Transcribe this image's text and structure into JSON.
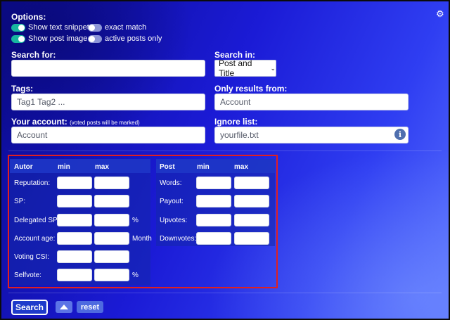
{
  "options": {
    "title": "Options:",
    "toggles": [
      {
        "label": "Show text snippets",
        "on": true
      },
      {
        "label": "exact match",
        "on": false
      },
      {
        "label": "Show post image",
        "on": true
      },
      {
        "label": "active posts only",
        "on": false
      }
    ]
  },
  "search_for": {
    "label": "Search for:",
    "value": ""
  },
  "search_in": {
    "label": "Search in:",
    "selected": "Post and Title"
  },
  "tags": {
    "label": "Tags:",
    "placeholder": "Tag1 Tag2 ..."
  },
  "only_results_from": {
    "label": "Only results from:",
    "placeholder": "Account"
  },
  "your_account": {
    "label": "Your account:",
    "note": "(voted posts will be marked)",
    "placeholder": "Account"
  },
  "ignore_list": {
    "label": "Ignore list:",
    "placeholder": "yourfile.txt"
  },
  "autor_panel": {
    "header": "Autor",
    "min": "min",
    "max": "max",
    "rows": [
      {
        "label": "Reputation:",
        "unit": ""
      },
      {
        "label": "SP:",
        "unit": ""
      },
      {
        "label": "Delegated SP:",
        "unit": "%"
      },
      {
        "label": "Account age:",
        "unit": "Month"
      },
      {
        "label": "Voting CSI:",
        "unit": ""
      },
      {
        "label": "Selfvote:",
        "unit": "%"
      }
    ]
  },
  "post_panel": {
    "header": "Post",
    "min": "min",
    "max": "max",
    "rows": [
      {
        "label": "Words:"
      },
      {
        "label": "Payout:"
      },
      {
        "label": "Upvotes:"
      },
      {
        "label": "Downvotes:"
      }
    ]
  },
  "buttons": {
    "search": "Search",
    "reset": "reset"
  },
  "icons": {
    "settings": "gear-icon",
    "info": "info-icon",
    "scroll_up": "caret-up-icon"
  },
  "colors": {
    "toggle_on": "#18b7a0",
    "toggle_off": "#8d96d8",
    "highlight_border": "#e02020"
  }
}
